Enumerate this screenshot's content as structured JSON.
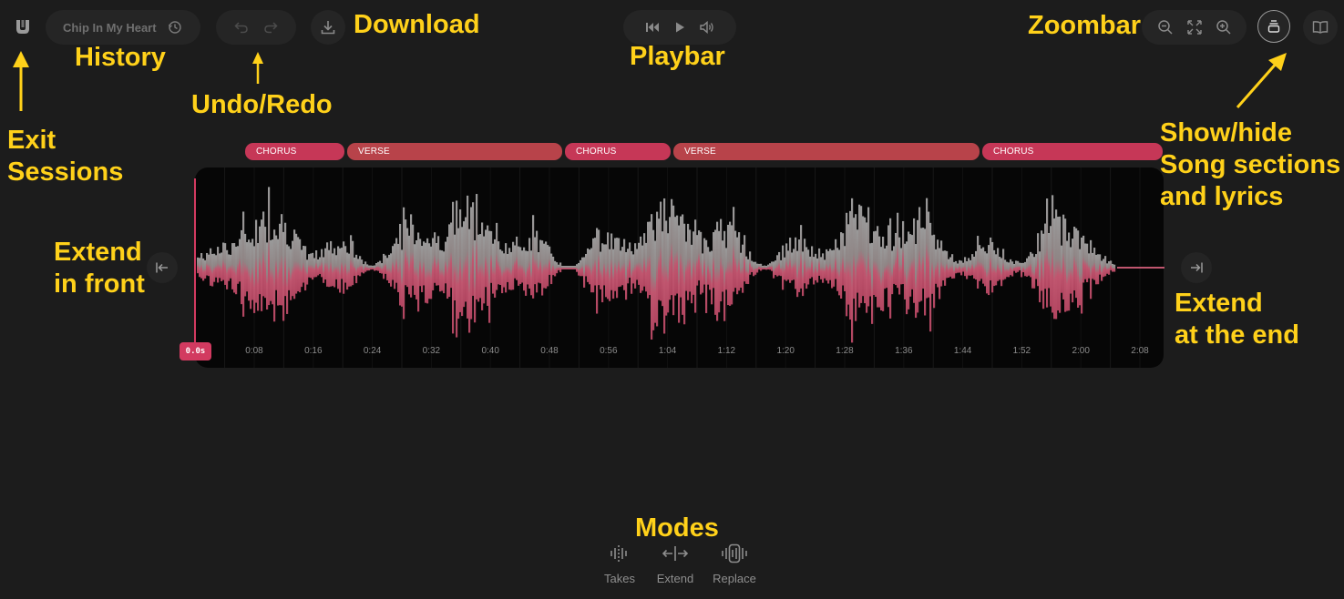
{
  "header": {
    "session_title": "Chip In My Heart"
  },
  "sections": [
    {
      "label": "CHORUS",
      "color": "#c63757"
    },
    {
      "label": "VERSE",
      "color": "#b8434a"
    },
    {
      "label": "CHORUS",
      "color": "#c63757"
    },
    {
      "label": "VERSE",
      "color": "#b8434a"
    },
    {
      "label": "CHORUS",
      "color": "#c63757"
    }
  ],
  "timeline": {
    "playhead_label": "0.0s",
    "ticks": [
      "0:08",
      "0:16",
      "0:24",
      "0:32",
      "0:40",
      "0:48",
      "0:56",
      "1:04",
      "1:12",
      "1:20",
      "1:28",
      "1:36",
      "1:44",
      "1:52",
      "2:00",
      "2:08"
    ]
  },
  "modes": [
    {
      "label": "Takes",
      "icon": "takes-icon"
    },
    {
      "label": "Extend",
      "icon": "extend-icon"
    },
    {
      "label": "Replace",
      "icon": "replace-icon"
    }
  ],
  "annotations": {
    "exit": "Exit\nSessions",
    "history": "History",
    "undo_redo": "Undo/Redo",
    "download": "Download",
    "playbar": "Playbar",
    "zoombar": "Zoombar",
    "show_hide": "Show/hide\nSong sections\nand lyrics",
    "extend_front": "Extend\nin front",
    "extend_end": "Extend\nat the end",
    "modes": "Modes"
  },
  "colors": {
    "accent": "#d23a60",
    "annotation": "#ffd11a",
    "background": "#1c1c1c"
  }
}
